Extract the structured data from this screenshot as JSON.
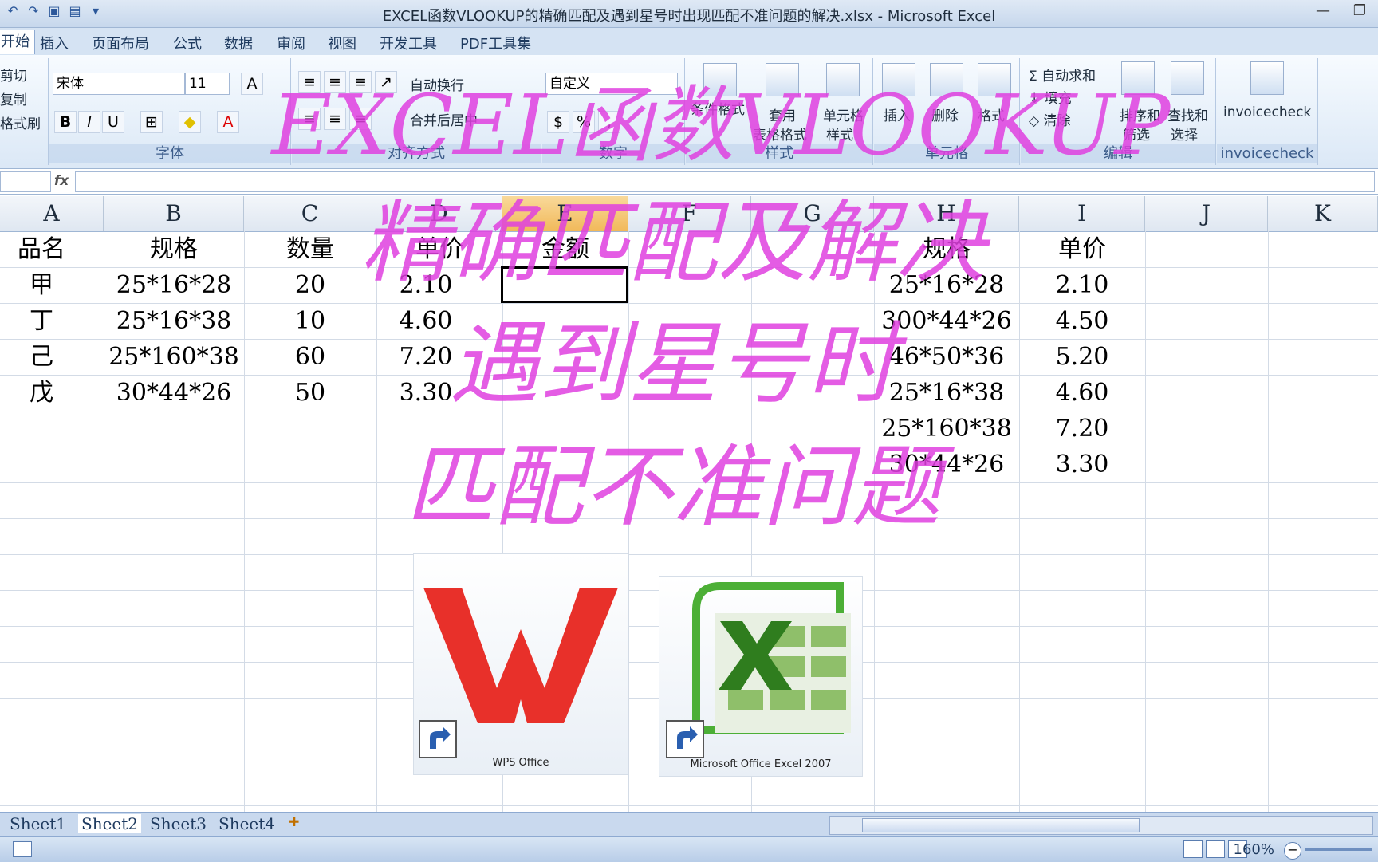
{
  "window": {
    "title": "EXCEL函数VLOOKUP的精确匹配及遇到星号时出现匹配不准问题的解决.xlsx - Microsoft Excel"
  },
  "tabs": [
    "开始",
    "插入",
    "页面布局",
    "公式",
    "数据",
    "审阅",
    "视图",
    "开发工具",
    "PDF工具集"
  ],
  "ribbon": {
    "clipboard": {
      "cut": "剪切",
      "copy": "复制",
      "format_painter": "格式刷"
    },
    "font": {
      "name": "宋体",
      "size": "11",
      "label": "字体"
    },
    "alignment": {
      "wrap": "自动换行",
      "merge": "合并后居中",
      "label": "对齐方式"
    },
    "number": {
      "format": "自定义",
      "label": "数字"
    },
    "styles": {
      "conditional": "条件格式",
      "table1": "套用",
      "table2": "表格格式",
      "cell1": "单元格",
      "cell2": "样式",
      "label": "样式"
    },
    "cells": {
      "insert": "插入",
      "delete": "删除",
      "format": "格式",
      "label": "单元格"
    },
    "editing": {
      "autosum": "自动求和",
      "fill": "填充",
      "clear": "清除",
      "sort1": "排序和",
      "sort2": "筛选",
      "find1": "查找和",
      "find2": "选择",
      "label": "编辑"
    },
    "addin": {
      "name": "invoicecheck",
      "label": "invoicecheck"
    }
  },
  "columns": [
    "A",
    "B",
    "C",
    "D",
    "E",
    "F",
    "G",
    "H",
    "I",
    "J",
    "K"
  ],
  "table1": {
    "headers": [
      "品名",
      "规格",
      "数量",
      "单价",
      "金额"
    ],
    "rows": [
      [
        "甲",
        "25*16*28",
        "20",
        "2.10",
        ""
      ],
      [
        "丁",
        "25*16*38",
        "10",
        "4.60",
        ""
      ],
      [
        "己",
        "25*160*38",
        "60",
        "7.20",
        ""
      ],
      [
        "戊",
        "30*44*26",
        "50",
        "3.30",
        ""
      ]
    ]
  },
  "table2": {
    "headers": [
      "规格",
      "单价"
    ],
    "rows": [
      [
        "25*16*28",
        "2.10"
      ],
      [
        "300*44*26",
        "4.50"
      ],
      [
        "46*50*36",
        "5.20"
      ],
      [
        "25*16*38",
        "4.60"
      ],
      [
        "25*160*38",
        "7.20"
      ],
      [
        "30*44*26",
        "3.30"
      ]
    ]
  },
  "overlay": {
    "line1": "EXCEL函数VLOOKUP",
    "line2": "精确匹配及解决",
    "line3": "遇到星号时",
    "line4": "匹配不准问题"
  },
  "desktop_icons": {
    "wps": "WPS Office",
    "excel": "Microsoft Office Excel 2007"
  },
  "sheets": [
    "Sheet1",
    "Sheet2",
    "Sheet3",
    "Sheet4"
  ],
  "status": {
    "zoom": "160%"
  },
  "colors": {
    "overlay": "#e040e0",
    "accent": "#2b579a"
  }
}
